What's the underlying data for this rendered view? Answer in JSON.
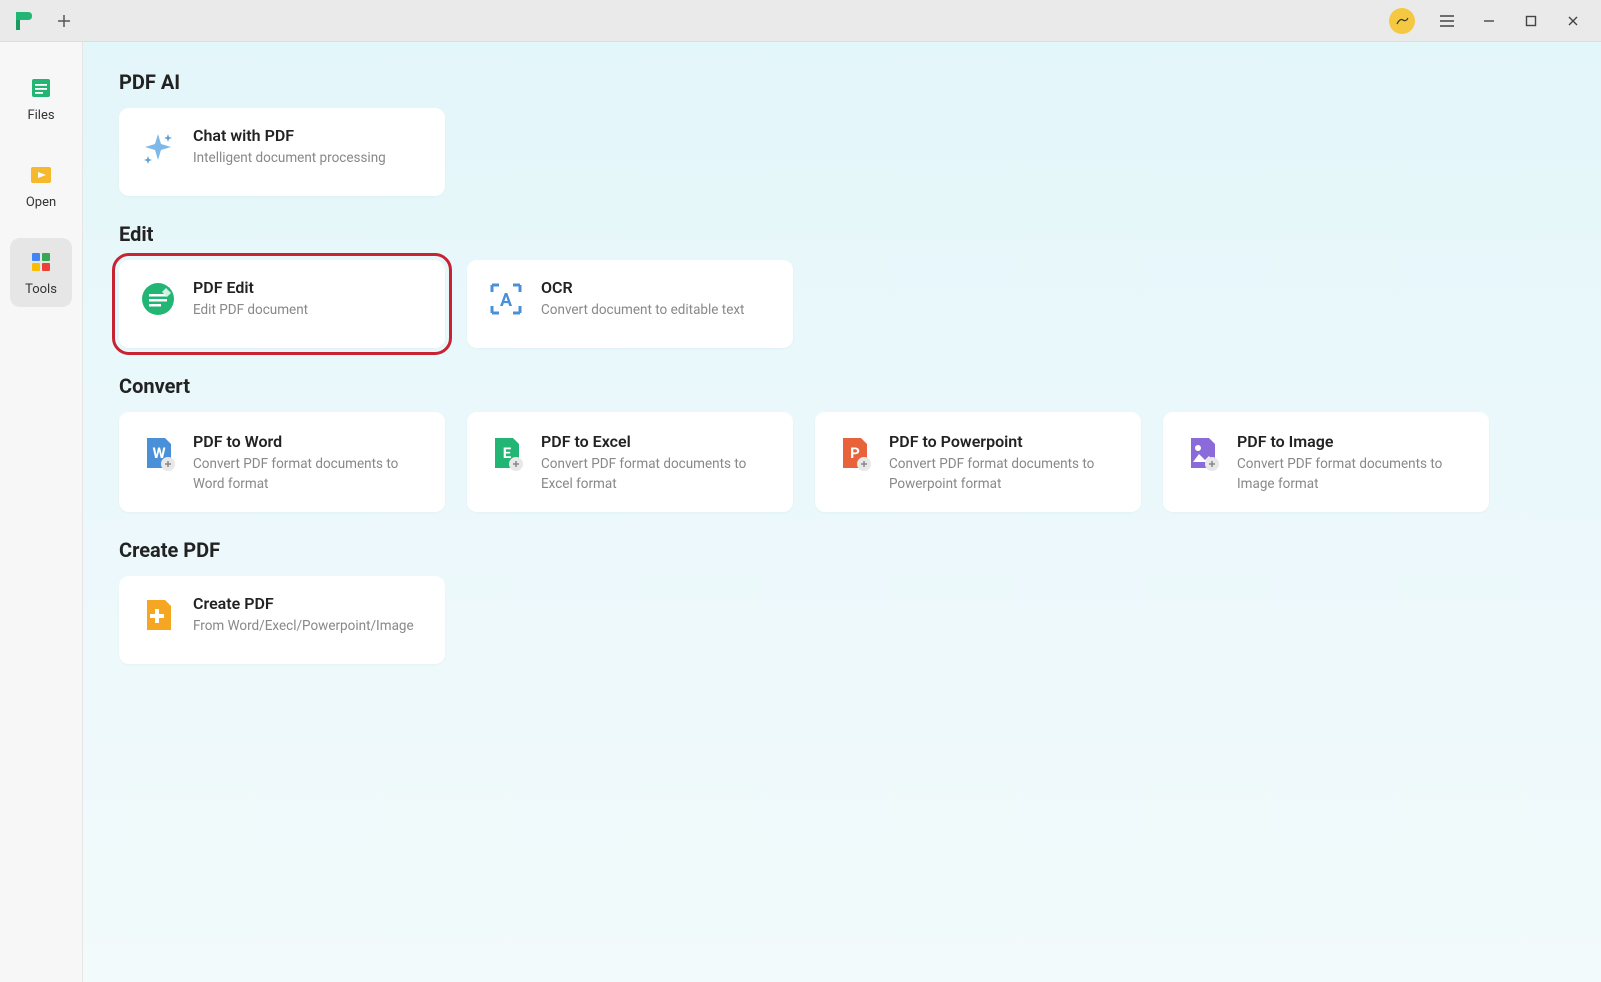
{
  "sidebar": {
    "items": [
      {
        "label": "Files"
      },
      {
        "label": "Open"
      },
      {
        "label": "Tools"
      }
    ]
  },
  "sections": {
    "pdf_ai": {
      "title": "PDF AI",
      "cards": [
        {
          "title": "Chat with PDF",
          "desc": "Intelligent document processing"
        }
      ]
    },
    "edit": {
      "title": "Edit",
      "cards": [
        {
          "title": "PDF Edit",
          "desc": "Edit PDF document"
        },
        {
          "title": "OCR",
          "desc": "Convert document to editable text"
        }
      ]
    },
    "convert": {
      "title": "Convert",
      "cards": [
        {
          "title": "PDF to Word",
          "desc": "Convert PDF format documents to Word format"
        },
        {
          "title": "PDF to Excel",
          "desc": "Convert PDF format documents to Excel format"
        },
        {
          "title": "PDF to Powerpoint",
          "desc": "Convert PDF format documents to Powerpoint format"
        },
        {
          "title": "PDF to Image",
          "desc": "Convert PDF format documents to Image format"
        }
      ]
    },
    "create": {
      "title": "Create PDF",
      "cards": [
        {
          "title": "Create PDF",
          "desc": "From Word/Execl/Powerpoint/Image"
        }
      ]
    }
  }
}
